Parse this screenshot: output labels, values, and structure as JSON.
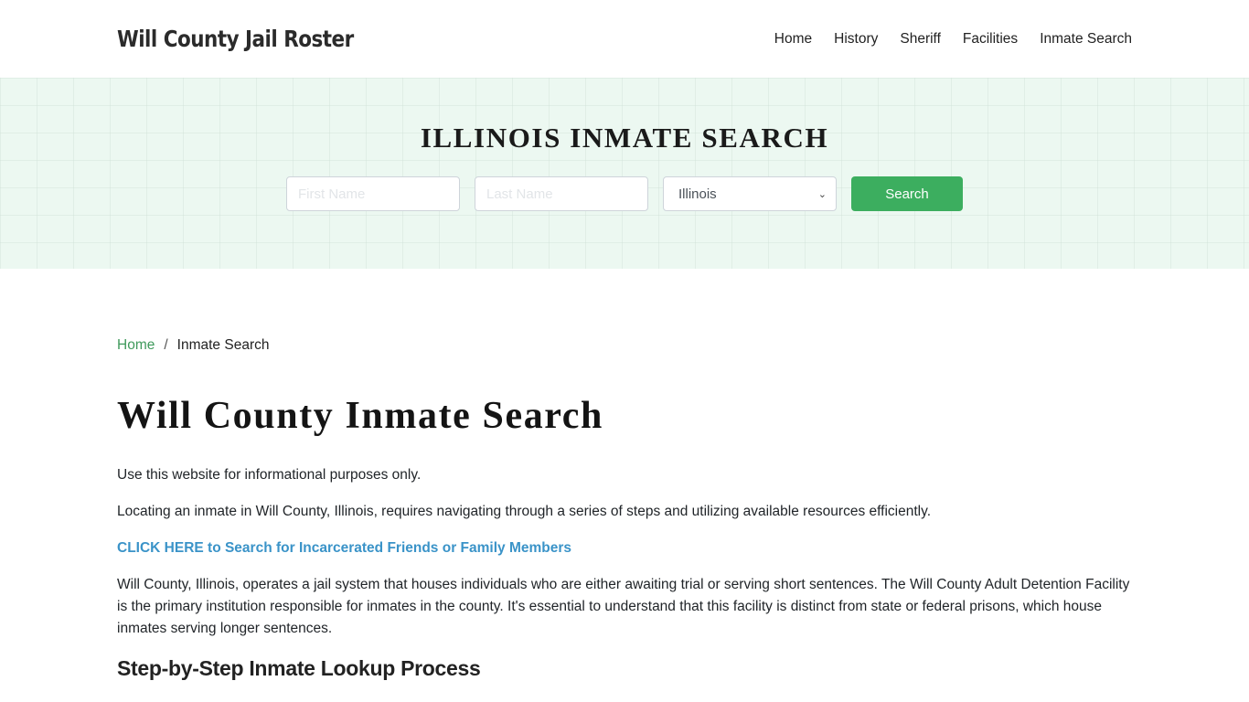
{
  "header": {
    "brand": "Will County Jail Roster",
    "nav": [
      {
        "label": "Home"
      },
      {
        "label": "History"
      },
      {
        "label": "Sheriff"
      },
      {
        "label": "Facilities"
      },
      {
        "label": "Inmate Search"
      }
    ]
  },
  "hero": {
    "title": "ILLINOIS INMATE SEARCH",
    "first_name_placeholder": "First Name",
    "last_name_placeholder": "Last Name",
    "state_selected": "Illinois",
    "search_label": "Search"
  },
  "breadcrumb": {
    "home": "Home",
    "separator": "/",
    "current": "Inmate Search"
  },
  "main": {
    "title": "Will County Inmate Search",
    "paragraphs": [
      "Use this website for informational purposes only.",
      "Locating an inmate in Will County, Illinois, requires navigating through a series of steps and utilizing available resources efficiently."
    ],
    "cta_link": "CLICK HERE to Search for Incarcerated Friends or Family Members",
    "body_paragraph": "Will County, Illinois, operates a jail system that houses individuals who are either awaiting trial or serving short sentences. The Will County Adult Detention Facility is the primary institution responsible for inmates in the county. It's essential to understand that this facility is distinct from state or federal prisons, which house inmates serving longer sentences.",
    "section_heading": "Step-by-Step Inmate Lookup Process"
  },
  "colors": {
    "accent_green": "#3cae5f",
    "link_green": "#3f9a5c",
    "cta_blue": "#3a93c8",
    "hero_bg": "#ecf8f1"
  }
}
